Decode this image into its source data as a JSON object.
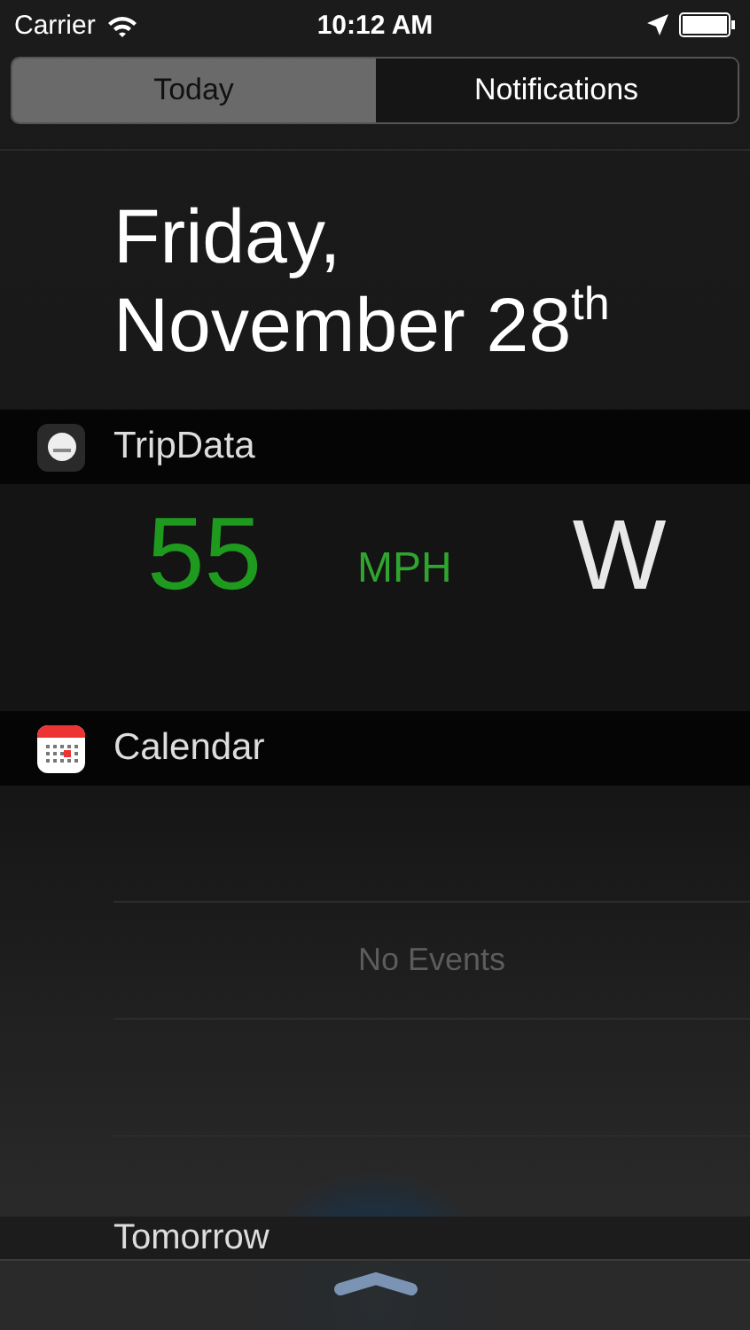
{
  "status_bar": {
    "carrier": "Carrier",
    "time": "10:12 AM"
  },
  "tabs": [
    {
      "label": "Today",
      "selected": true
    },
    {
      "label": "Notifications",
      "selected": false
    }
  ],
  "date": {
    "weekday": "Friday,",
    "day": "November 28$^{th}$"
  },
  "tripdata": {
    "title": "TripData",
    "speed": "55",
    "unit": "MPH",
    "heading": "W"
  },
  "calendar": {
    "title": "Calendar",
    "empty_message": "No Events"
  },
  "next_section": "Tomorrow"
}
